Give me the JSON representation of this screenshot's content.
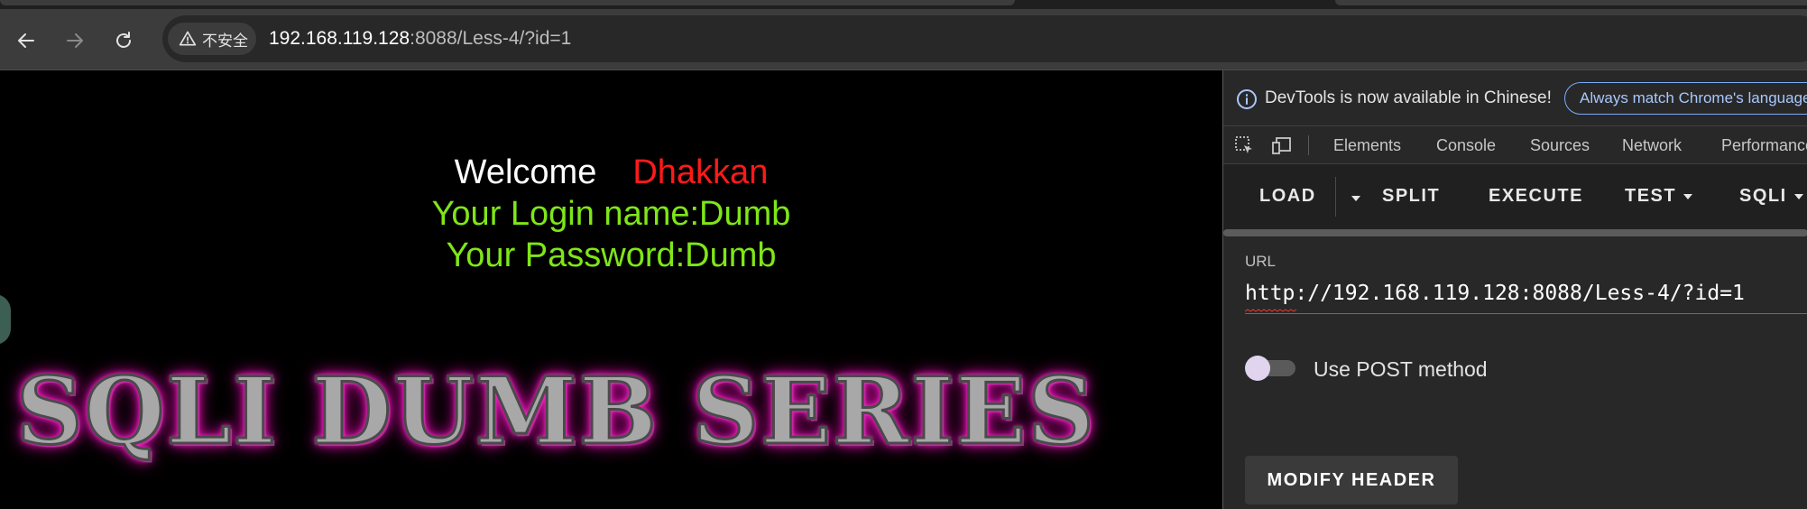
{
  "browser": {
    "security_label": "不安全",
    "url_host": "192.168.119.128",
    "url_rest": ":8088/Less-4/?id=1"
  },
  "page": {
    "welcome_word": "Welcome",
    "welcome_name": "Dhakkan",
    "login_line": "Your Login name:Dumb",
    "password_line": "Your Password:Dumb",
    "banner_text": "SQLI DUMB SERIES",
    "colors": {
      "welcome": "#ffffff",
      "name": "#ff1a1a",
      "credentials": "#7fe617",
      "banner_glow": "#ff2fd0"
    }
  },
  "devtools": {
    "info_message": "DevTools is now available in Chinese!",
    "match_language_button": "Always match Chrome's language",
    "tabs": [
      "Elements",
      "Console",
      "Sources",
      "Network",
      "Performance"
    ],
    "hackbar": {
      "buttons": [
        "LOAD",
        "SPLIT",
        "EXECUTE",
        "TEST",
        "SQLI"
      ],
      "url_label": "URL",
      "url_value": "http://192.168.119.128:8088/Less-4/?id=1",
      "post_toggle_label": "Use POST method",
      "post_enabled": false,
      "modify_header_button": "MODIFY HEADER"
    }
  }
}
